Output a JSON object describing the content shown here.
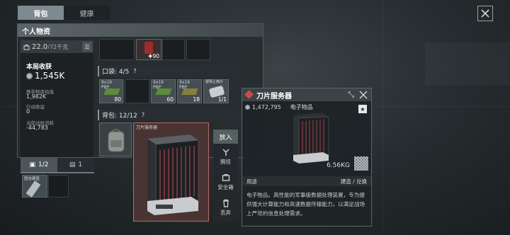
{
  "tabs": [
    {
      "label": "背包",
      "active": true
    },
    {
      "label": "健康",
      "active": false
    }
  ],
  "personal": {
    "title": "个人物资",
    "weight_current": "22.0",
    "weight_max": "/72千克",
    "income_title": "本局收获",
    "income_value": "1,545K",
    "carried_value_label": "携带物资估值",
    "carried_value": "1,982K",
    "action_income_label": "行动收益",
    "action_income": "0",
    "consumption_label": "当前战局消耗",
    "consumption": "-44,783"
  },
  "top_item": {
    "qty": "90"
  },
  "pocket": {
    "label": "口袋: 4/5",
    "help": "?",
    "items": [
      {
        "caliber": "9x19\nPBP",
        "qty": "80"
      },
      {
        "caliber": "9x19\nPBP",
        "qty": "60"
      },
      {
        "caliber": "9x19\nPBP",
        "qty": "18"
      },
      {
        "caliber": "缓释止痛片",
        "qty": "1/1"
      }
    ]
  },
  "backpack": {
    "label": "背包: 12/12",
    "help": "?",
    "selected_item_name": "刀片服务器"
  },
  "bottom_tabs": [
    {
      "label": "1/2",
      "icon": "briefcase-icon",
      "active": true
    },
    {
      "label": "1",
      "icon": "clipboard-icon",
      "active": false
    }
  ],
  "container_item": {
    "name": "固态硬盘"
  },
  "context_menu": {
    "header": "放入",
    "items": [
      {
        "label": "腕挂",
        "icon": "arm-icon"
      },
      {
        "label": "安全箱",
        "icon": "safebox-icon"
      },
      {
        "label": "丢弃",
        "icon": "trash-icon"
      }
    ]
  },
  "detail": {
    "name": "刀片服务器",
    "price": "1,472,795",
    "category": "电子物品",
    "weight": "6.56KG",
    "usage_label": "用途",
    "usage_links": "建造 / 兑换",
    "description": "电子物品。高性能的军事级数据处理装置，专为提供强大计算能力和高速数据传输能力，以满足战场上严苛的信息处理需求。",
    "rarity_color": "#c94b4b"
  },
  "colors": {
    "accent": "#7e8a8f",
    "selected_bg": "#5a3c3c",
    "selected_border": "#b86a6a",
    "ammo_green": "#5f8a3a"
  }
}
